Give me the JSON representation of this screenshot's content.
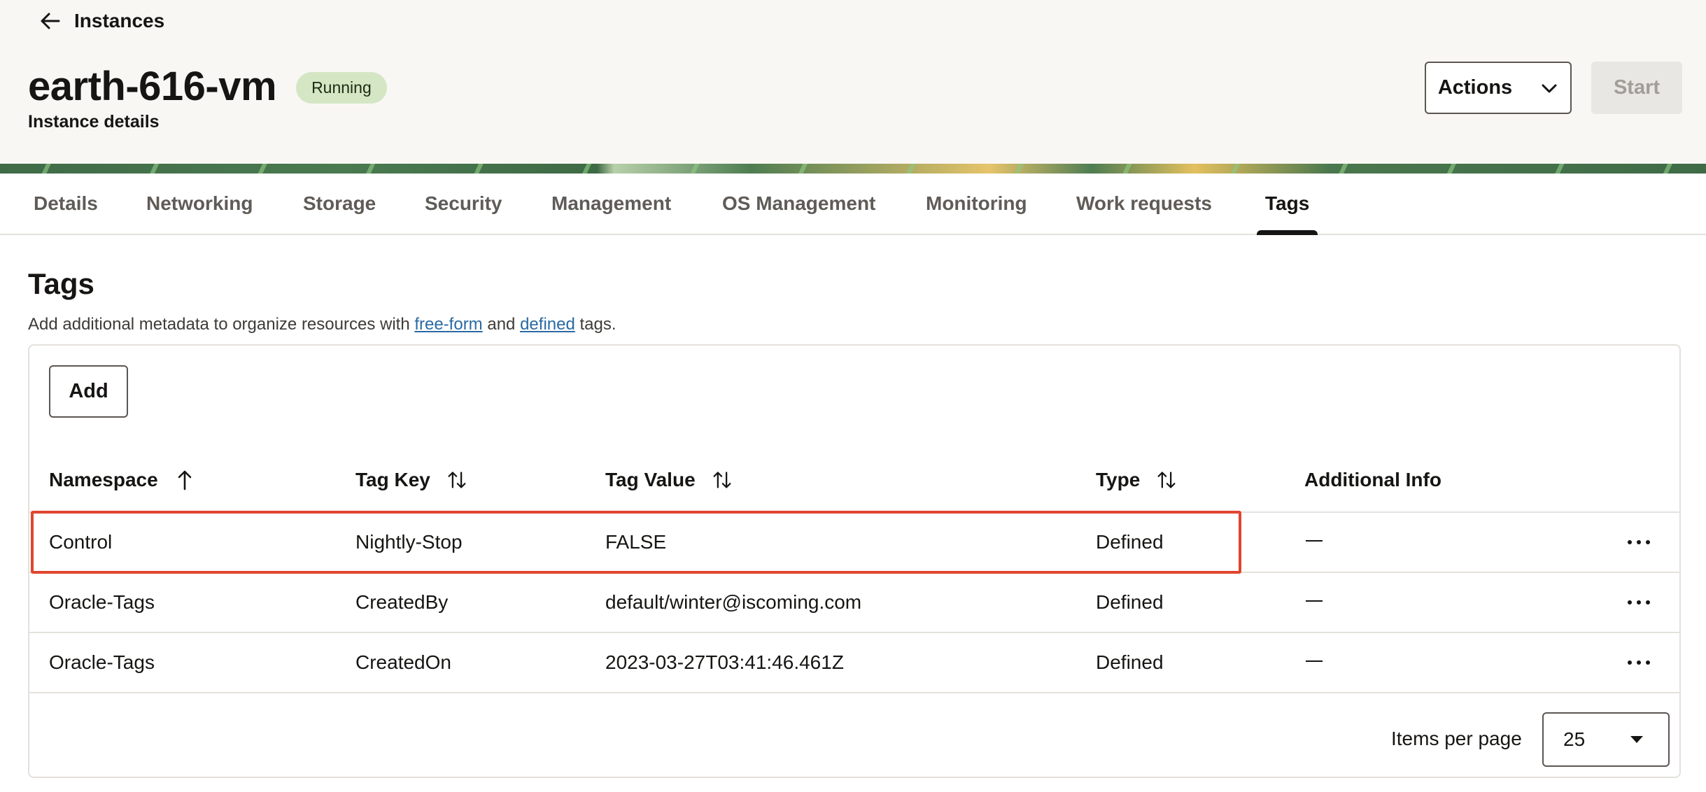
{
  "header": {
    "back_label": "Instances",
    "title": "earth-616-vm",
    "status": "Running",
    "subtitle": "Instance details",
    "actions_label": "Actions",
    "start_label": "Start"
  },
  "tabs": [
    {
      "label": "Details"
    },
    {
      "label": "Networking"
    },
    {
      "label": "Storage"
    },
    {
      "label": "Security"
    },
    {
      "label": "Management"
    },
    {
      "label": "OS Management"
    },
    {
      "label": "Monitoring"
    },
    {
      "label": "Work requests"
    },
    {
      "label": "Tags",
      "active": true
    }
  ],
  "section": {
    "title": "Tags",
    "desc_before": "Add additional metadata to organize resources with ",
    "link_freeform": "free-form",
    "desc_and": " and ",
    "link_defined": "defined",
    "desc_after": " tags."
  },
  "table": {
    "add_label": "Add",
    "columns": {
      "namespace": "Namespace",
      "tag_key": "Tag Key",
      "tag_value": "Tag Value",
      "type": "Type",
      "additional_info": "Additional Info"
    },
    "rows": [
      {
        "namespace": "Control",
        "tag_key": "Nightly-Stop",
        "tag_value": "FALSE",
        "type": "Defined",
        "highlighted": true
      },
      {
        "namespace": "Oracle-Tags",
        "tag_key": "CreatedBy",
        "tag_value": "default/winter@iscoming.com",
        "type": "Defined"
      },
      {
        "namespace": "Oracle-Tags",
        "tag_key": "CreatedOn",
        "tag_value": "2023-03-27T03:41:46.461Z",
        "type": "Defined"
      }
    ]
  },
  "pagination": {
    "label": "Items per page",
    "value": "25"
  },
  "colors": {
    "accent_link": "#2b6aa3",
    "status_badge_bg": "#d4e6c4",
    "highlight_border": "#e0452f"
  }
}
